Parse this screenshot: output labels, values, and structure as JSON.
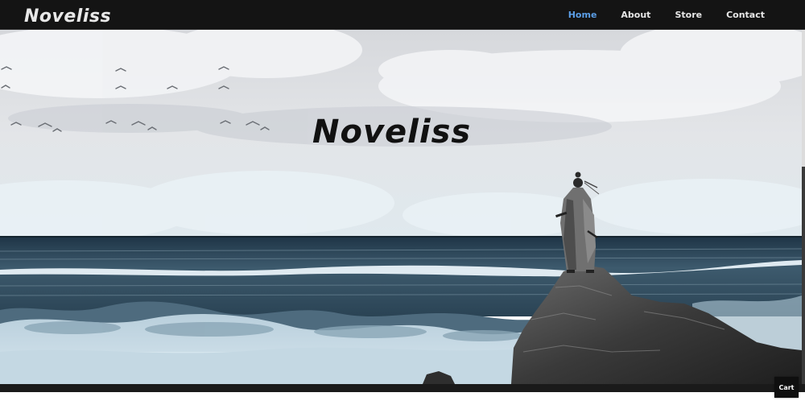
{
  "brand": {
    "logo_text": "Noveliss"
  },
  "nav": {
    "items": [
      {
        "label": "Home",
        "active": true
      },
      {
        "label": "About",
        "active": false
      },
      {
        "label": "Store",
        "active": false
      },
      {
        "label": "Contact",
        "active": false
      }
    ]
  },
  "hero": {
    "title_logo_text": "Noveliss"
  },
  "cart": {
    "label": "Cart"
  },
  "colors": {
    "nav_background": "#141414",
    "nav_active": "#5b9ee6",
    "nav_text": "#e6e6e6",
    "sky": "#dfe3e8",
    "sea": "#2e4a5c",
    "foam": "#c9dbe6"
  }
}
